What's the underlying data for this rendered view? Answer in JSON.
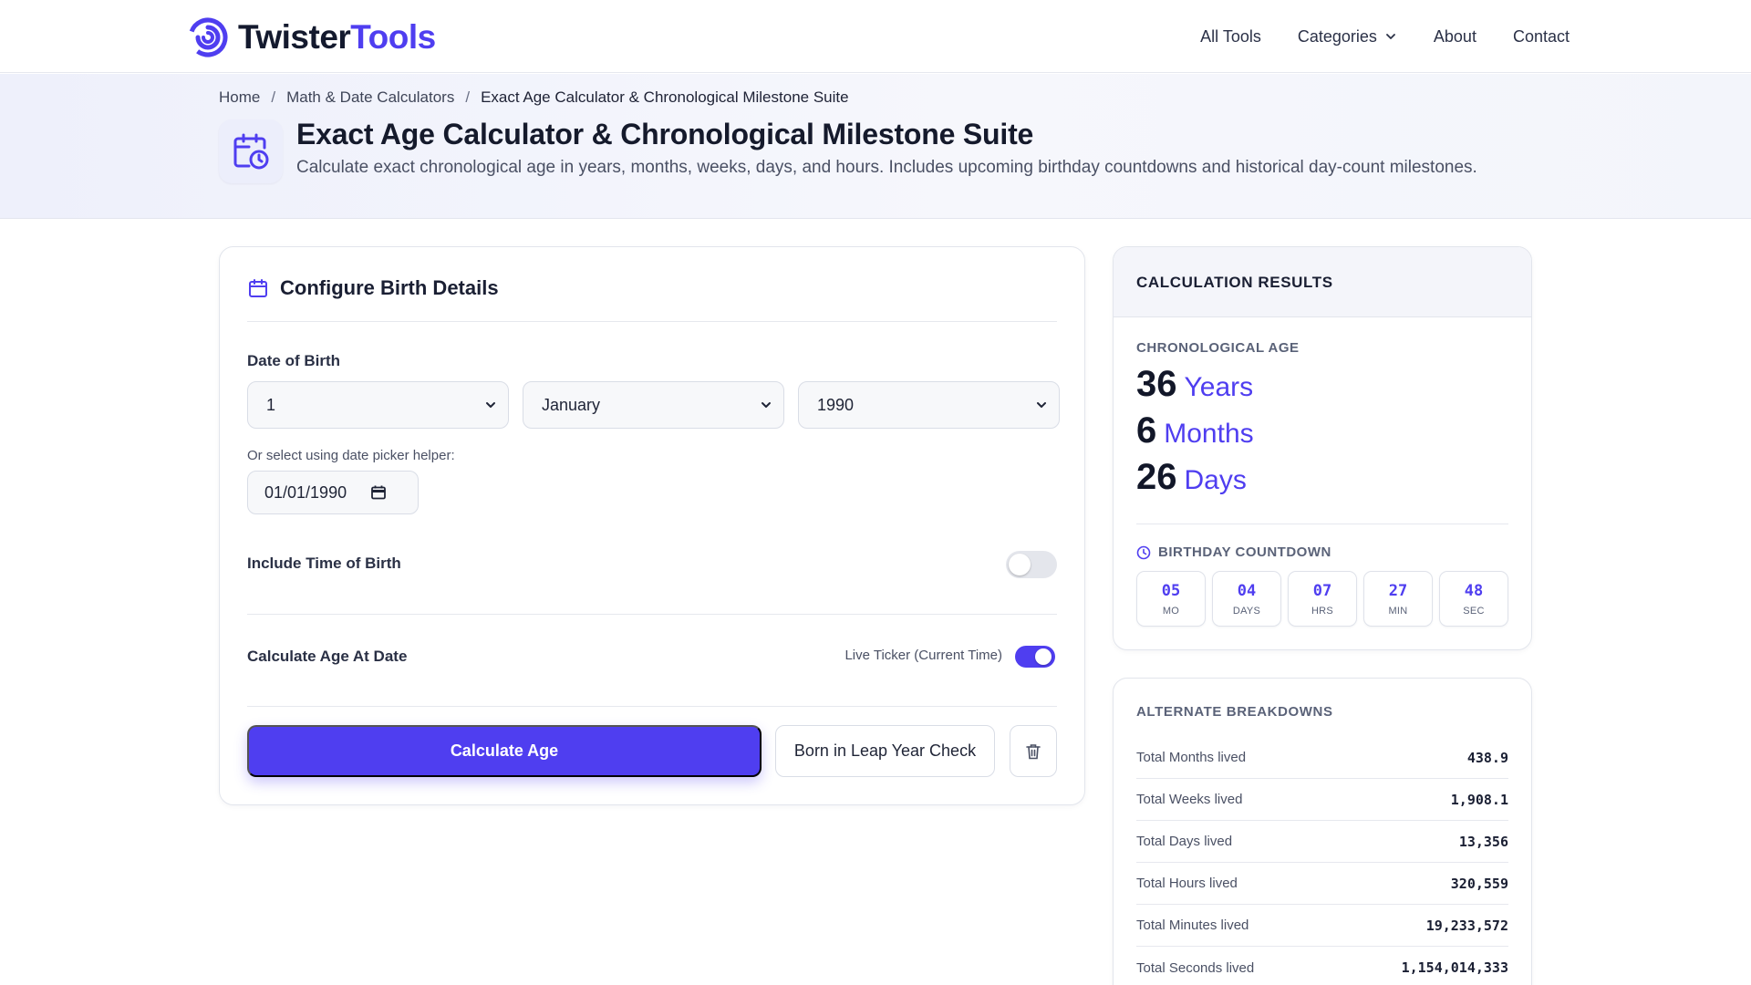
{
  "brand": {
    "name_part1": "Twister",
    "name_part2": "Tools",
    "accent": "#4f3ef0"
  },
  "nav": {
    "all_tools": "All Tools",
    "categories": "Categories",
    "about": "About",
    "contact": "Contact"
  },
  "breadcrumb": {
    "home": "Home",
    "category": "Math & Date Calculators",
    "current": "Exact Age Calculator & Chronological Milestone Suite",
    "separator": "/"
  },
  "hero": {
    "title": "Exact Age Calculator & Chronological Milestone Suite",
    "subtitle": "Calculate exact chronological age in years, months, weeks, days, and hours. Includes upcoming birthday countdowns and historical day-count milestones."
  },
  "config": {
    "title": "Configure Birth Details",
    "dob_label": "Date of Birth",
    "day_value": "1",
    "month_value": "January",
    "year_value": "1990",
    "helper_text": "Or select using date picker helper:",
    "date_picker_value": "01/01/1990",
    "time_of_birth_label": "Include Time of Birth",
    "time_of_birth_enabled": false,
    "age_at_date_label": "Calculate Age At Date",
    "live_ticker_label": "Live Ticker (Current Time)",
    "live_ticker_enabled": true,
    "calculate_button": "Calculate Age",
    "leap_year_button": "Born in Leap Year Check"
  },
  "results": {
    "title": "CALCULATION RESULTS",
    "age_label": "CHRONOLOGICAL AGE",
    "years": "36",
    "years_unit": "Years",
    "months": "6",
    "months_unit": "Months",
    "days": "26",
    "days_unit": "Days",
    "countdown_label": "BIRTHDAY COUNTDOWN",
    "countdown": [
      {
        "value": "05",
        "unit": "MO"
      },
      {
        "value": "04",
        "unit": "DAYS"
      },
      {
        "value": "07",
        "unit": "HRS"
      },
      {
        "value": "27",
        "unit": "MIN"
      },
      {
        "value": "48",
        "unit": "SEC"
      }
    ]
  },
  "breakdown": {
    "title": "ALTERNATE BREAKDOWNS",
    "rows": [
      {
        "label": "Total Months lived",
        "value": "438.9"
      },
      {
        "label": "Total Weeks lived",
        "value": "1,908.1"
      },
      {
        "label": "Total Days lived",
        "value": "13,356"
      },
      {
        "label": "Total Hours lived",
        "value": "320,559"
      },
      {
        "label": "Total Minutes lived",
        "value": "19,233,572"
      },
      {
        "label": "Total Seconds lived",
        "value": "1,154,014,333"
      }
    ]
  }
}
